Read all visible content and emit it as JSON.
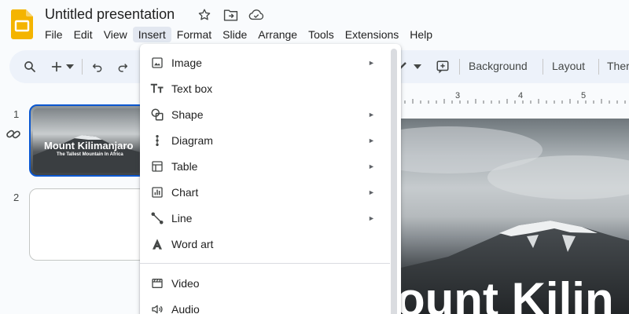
{
  "title_bar": {
    "doc_title": "Untitled presentation",
    "icons": [
      "star-icon",
      "move-to-folder-icon",
      "cloud-saved-icon"
    ]
  },
  "menubar": {
    "items": [
      "File",
      "Edit",
      "View",
      "Insert",
      "Format",
      "Slide",
      "Arrange",
      "Tools",
      "Extensions",
      "Help"
    ],
    "active": "Insert"
  },
  "toolbar": {
    "background_label": "Background",
    "layout_label": "Layout",
    "theme_label": "Ther"
  },
  "filmstrip": {
    "slides": [
      {
        "number": "1",
        "title": "Mount Kilimanjaro",
        "subtitle": "The Tallest Mountain In Africa"
      },
      {
        "number": "2"
      }
    ]
  },
  "ruler": {
    "marks": [
      "3",
      "4",
      "5"
    ]
  },
  "canvas": {
    "visible_text": "ount Kilin"
  },
  "insert_menu": {
    "items": [
      {
        "label": "Image",
        "icon": "image-icon",
        "submenu": true
      },
      {
        "label": "Text box",
        "icon": "text-box-icon",
        "submenu": false
      },
      {
        "label": "Shape",
        "icon": "shape-icon",
        "submenu": true
      },
      {
        "label": "Diagram",
        "icon": "diagram-icon",
        "submenu": true
      },
      {
        "label": "Table",
        "icon": "table-icon",
        "submenu": true
      },
      {
        "label": "Chart",
        "icon": "chart-icon",
        "submenu": true
      },
      {
        "label": "Line",
        "icon": "line-icon",
        "submenu": true
      },
      {
        "label": "Word art",
        "icon": "word-art-icon",
        "submenu": false
      },
      {
        "label": "Video",
        "icon": "video-icon",
        "submenu": false
      },
      {
        "label": "Audio",
        "icon": "audio-icon",
        "submenu": false
      }
    ]
  },
  "colors": {
    "accent_blue": "#0b57d0",
    "toolbar_bg": "#edf2fa",
    "menu_active_bg": "#e2e7f0",
    "slides_logo": "#f4b400"
  }
}
